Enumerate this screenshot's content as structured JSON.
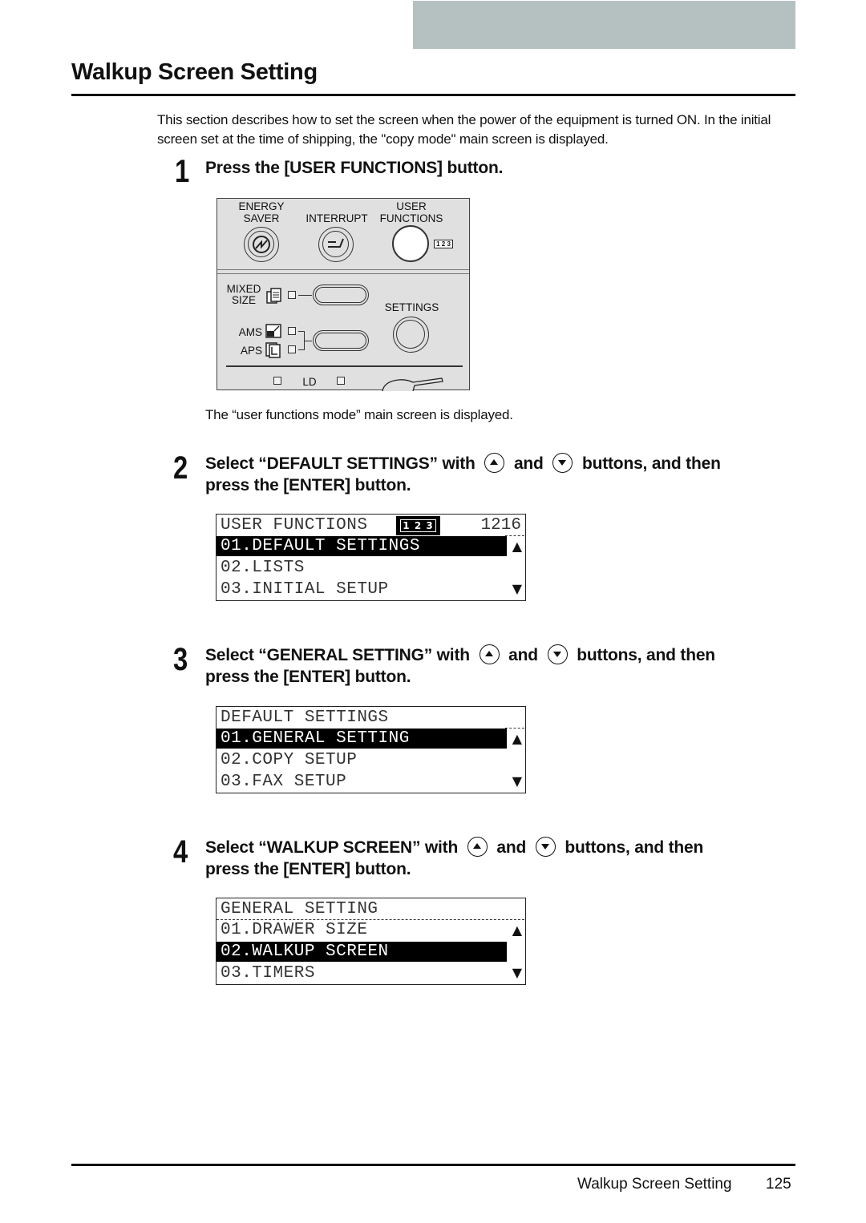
{
  "header": {
    "title": "Walkup Screen Setting",
    "intro": "This section describes how to set the screen when the power of the equipment is turned ON. In the initial screen set at the time of shipping, the \"copy mode\" main screen is displayed."
  },
  "steps": [
    {
      "number": "1",
      "text": "Press the [USER FUNCTIONS] button.",
      "panel": {
        "energy_saver_label_1": "ENERGY",
        "energy_saver_label_2": "SAVER",
        "interrupt_label": "INTERRUPT",
        "user_functions_label_1": "USER",
        "user_functions_label_2": "FUNCTIONS",
        "indicator_badge": "1 2 3",
        "mixed_size_label_1": "MIXED",
        "mixed_size_label_2": "SIZE",
        "settings_label": "SETTINGS",
        "ams_label": "AMS",
        "aps_label": "APS",
        "ld_label": "LD"
      },
      "caption": "The “user functions mode” main screen is displayed."
    },
    {
      "number": "2",
      "text_pre": "Select “DEFAULT SETTINGS” with",
      "and": "and",
      "text_post": "buttons, and then",
      "text_line2": "press the [ENTER] button.",
      "lcd": {
        "header": "USER FUNCTIONS",
        "badge": "1 2 3",
        "count": "1216",
        "rows": [
          "01.DEFAULT SETTINGS",
          "02.LISTS",
          "03.INITIAL SETUP"
        ],
        "selected_index": 0
      }
    },
    {
      "number": "3",
      "text_pre": "Select “GENERAL SETTING” with",
      "and": "and",
      "text_post": "buttons, and then",
      "text_line2": "press the [ENTER] button.",
      "lcd": {
        "header": "DEFAULT SETTINGS",
        "rows": [
          "01.GENERAL SETTING",
          "02.COPY SETUP",
          "03.FAX SETUP"
        ],
        "selected_index": 0
      }
    },
    {
      "number": "4",
      "text_pre": "Select “WALKUP SCREEN” with",
      "and": "and",
      "text_post": "buttons, and then",
      "text_line2": "press the [ENTER] button.",
      "lcd": {
        "header": "GENERAL SETTING",
        "rows": [
          "01.DRAWER SIZE",
          "02.WALKUP SCREEN",
          "03.TIMERS"
        ],
        "selected_index": 1
      }
    }
  ],
  "footer": {
    "section_title": "Walkup Screen Setting",
    "page_number": "125"
  },
  "icons": {
    "up": "▲",
    "down": "▼"
  }
}
